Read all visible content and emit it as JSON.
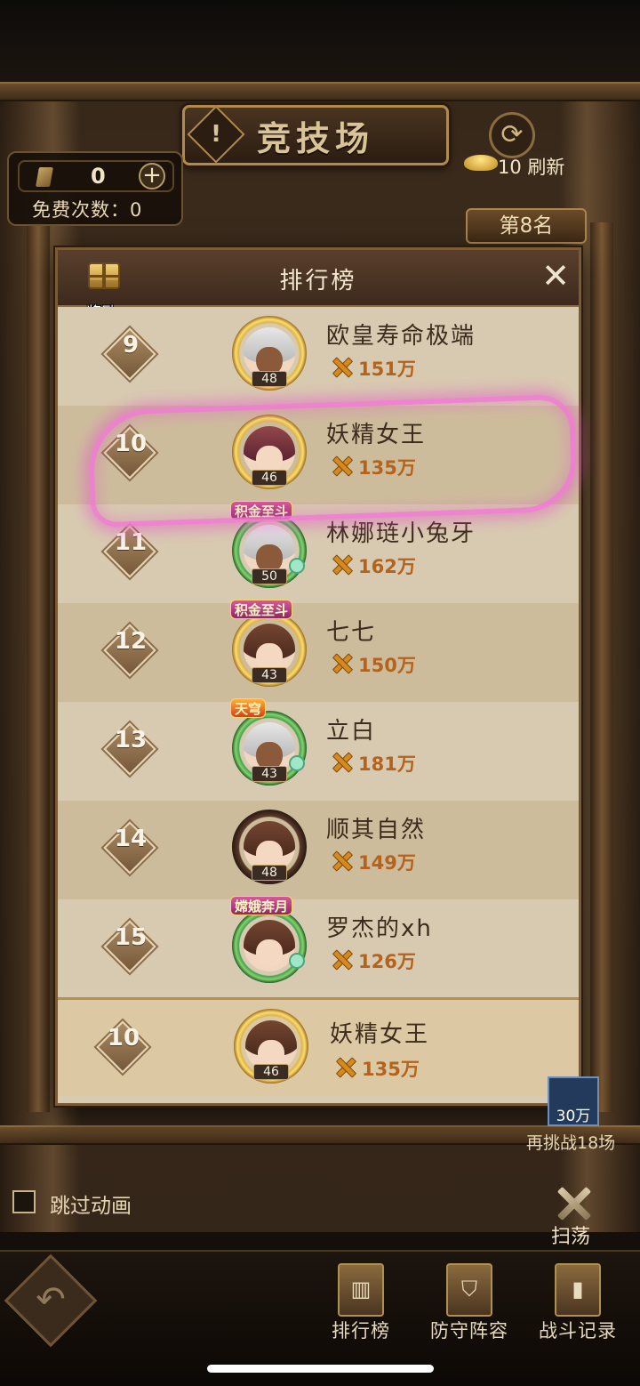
{
  "header": {
    "title": "竞技场",
    "info_symbol": "!",
    "tickets": "0",
    "plus": "+",
    "free_times": "免费次数：0",
    "refresh": "10 刷新",
    "my_rank": "第8名"
  },
  "leaderboard": {
    "title": "排行榜",
    "reward_label": "奖励",
    "close": "✕",
    "rows": [
      {
        "rank": "9",
        "name": "欧皇寿命极端",
        "power": "151万",
        "level": "48",
        "tag": ""
      },
      {
        "rank": "10",
        "name": "妖精女王",
        "power": "135万",
        "level": "46",
        "tag": ""
      },
      {
        "rank": "11",
        "name": "林娜琏小兔牙",
        "power": "162万",
        "level": "50",
        "tag": "积金至斗"
      },
      {
        "rank": "12",
        "name": "七七",
        "power": "150万",
        "level": "43",
        "tag": "积金至斗"
      },
      {
        "rank": "13",
        "name": "立白",
        "power": "181万",
        "level": "43",
        "tag": "天穹"
      },
      {
        "rank": "14",
        "name": "顺其自然",
        "power": "149万",
        "level": "48",
        "tag": ""
      },
      {
        "rank": "15",
        "name": "罗杰的xh",
        "power": "126万",
        "level": "",
        "tag": "嫦娥奔月"
      }
    ],
    "me": {
      "rank": "10",
      "name": "妖精女王",
      "power": "135万",
      "level": "46"
    }
  },
  "footer": {
    "power_badge": "30万",
    "rechallenge": "再挑战18场",
    "skip_animation": "跳过动画",
    "sweep": "扫荡",
    "back_symbol": "↶",
    "nav": [
      {
        "label": "排行榜",
        "icon": "bar-chart-icon"
      },
      {
        "label": "防守阵容",
        "icon": "shield-icon"
      },
      {
        "label": "战斗记录",
        "icon": "scroll-icon"
      }
    ]
  }
}
